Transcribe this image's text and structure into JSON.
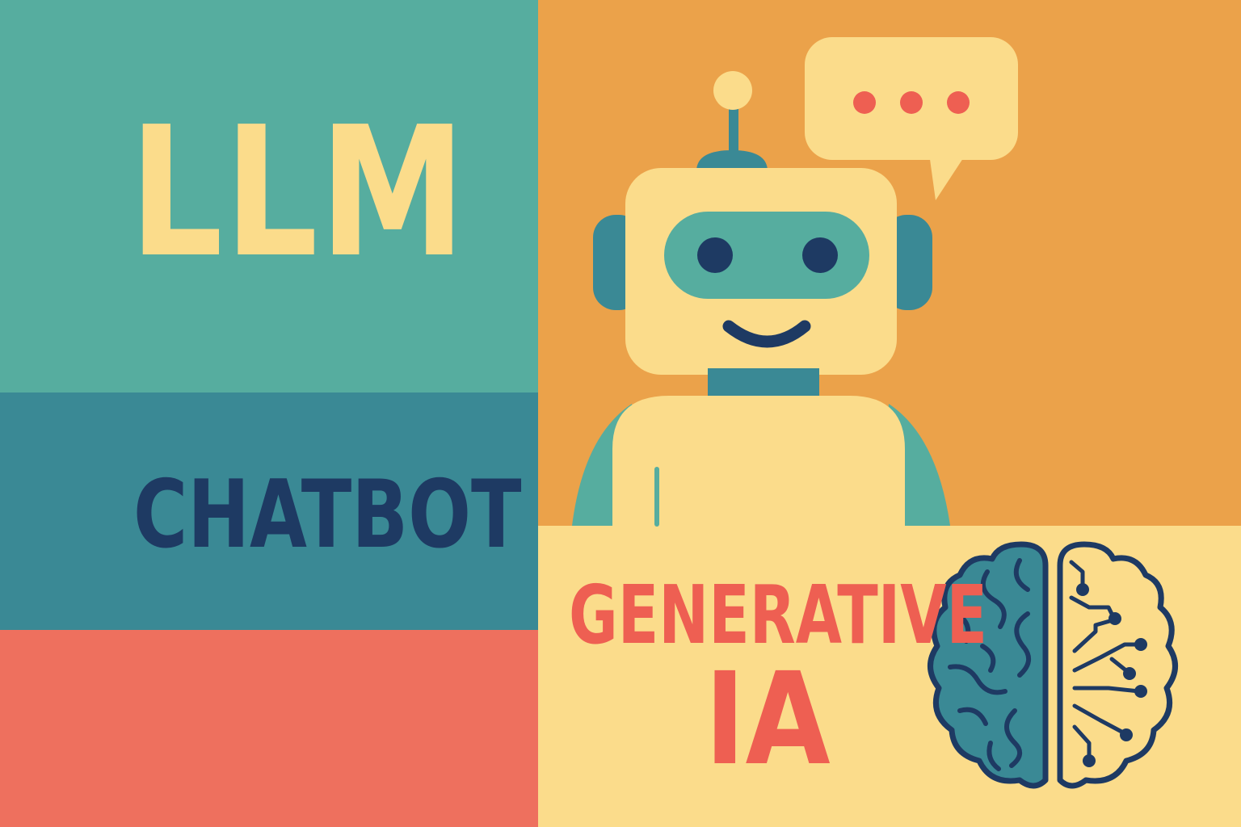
{
  "poster": {
    "words": {
      "llm": "LLM",
      "chatbot": "CHATBOT",
      "generative": "GENERATIVE",
      "ia": "IA"
    },
    "illustrations": {
      "robot": "robot-icon",
      "speech_bubble": "speech-bubble-icon",
      "brain": "brain-circuit-icon"
    },
    "colors": {
      "teal": "#56ad9f",
      "blue": "#3a8995",
      "coral": "#ee705e",
      "orange": "#eba24a",
      "cream": "#fbdc8b",
      "navy": "#1e3a63",
      "red_text": "#ee5f52"
    }
  }
}
